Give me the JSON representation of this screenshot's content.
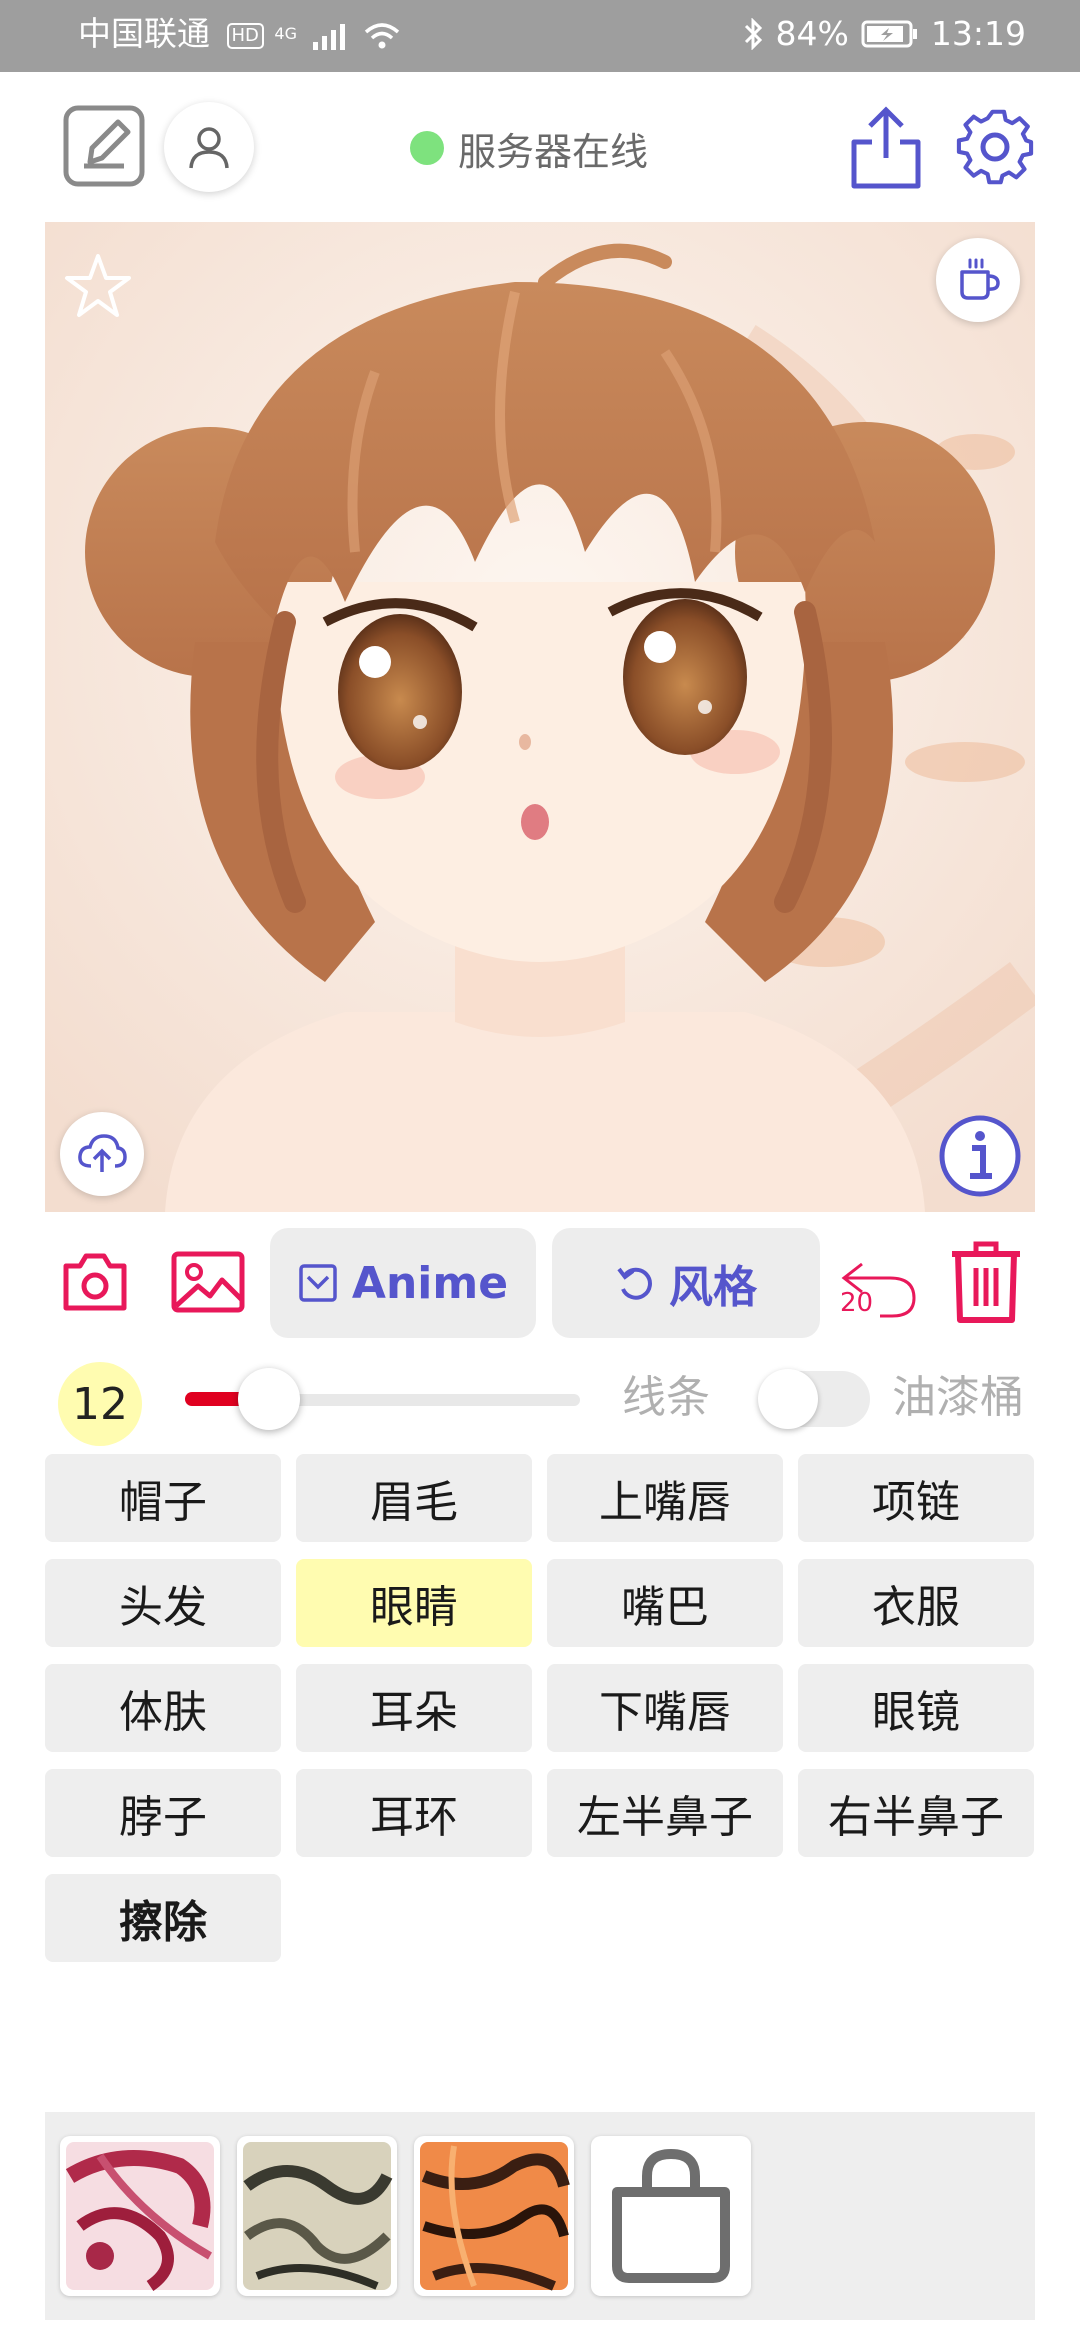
{
  "status_bar": {
    "carrier": "中国联通",
    "hd": "HD",
    "network": "4G",
    "battery": "84%",
    "time": "13:19"
  },
  "header": {
    "server_status": "服务器在线",
    "icons": [
      "edit-icon",
      "user-icon",
      "share-icon",
      "gear-icon"
    ]
  },
  "actions": {
    "mode_label": "Anime",
    "style_label": "风格",
    "undo_count": "20"
  },
  "brush": {
    "size": "12",
    "slider_fraction": 0.2,
    "lines_label": "线条",
    "bucket_label": "油漆桶",
    "bucket_enabled": false
  },
  "parts": [
    {
      "label": "帽子"
    },
    {
      "label": "眉毛"
    },
    {
      "label": "上嘴唇"
    },
    {
      "label": "项链"
    },
    {
      "label": "头发"
    },
    {
      "label": "眼睛",
      "selected": true
    },
    {
      "label": "嘴巴"
    },
    {
      "label": "衣服"
    },
    {
      "label": "体肤"
    },
    {
      "label": "耳朵"
    },
    {
      "label": "下嘴唇"
    },
    {
      "label": "眼镜"
    },
    {
      "label": "脖子"
    },
    {
      "label": "耳环"
    },
    {
      "label": "左半鼻子"
    },
    {
      "label": "右半鼻子"
    },
    {
      "label": "擦除",
      "bold": true
    }
  ],
  "colors": {
    "accent_red": "#e8185a",
    "accent_blue": "#5555cc",
    "selected_bg": "#fffcb0",
    "online_dot": "#7ee27e"
  }
}
